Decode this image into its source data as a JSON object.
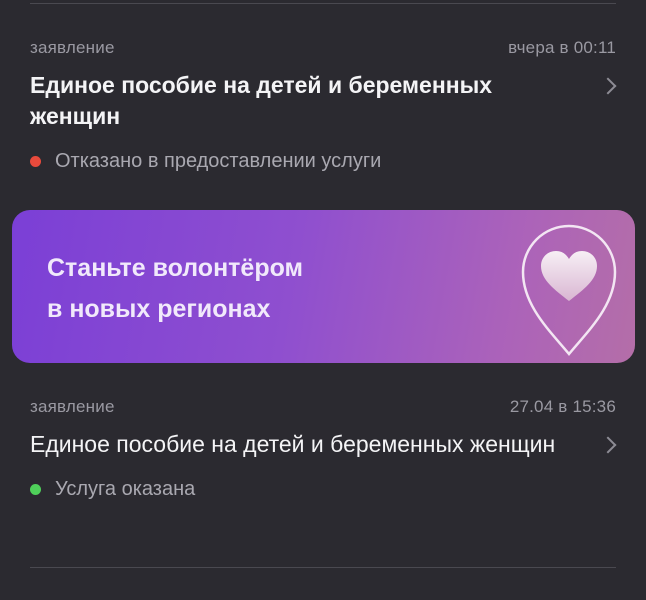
{
  "items": [
    {
      "type_label": "заявление",
      "time": "вчера в 00:11",
      "title": "Единое пособие на детей и беременных женщин",
      "status": "Отказано в предоставлении услуги",
      "status_color": "#e84a3c"
    },
    {
      "type_label": "заявление",
      "time": "27.04 в 15:36",
      "title": "Единое пособие на детей и беременных женщин",
      "status": "Услуга оказана",
      "status_color": "#4fd05a"
    }
  ],
  "banner": {
    "line1": "Станьте волонтёром",
    "line2": "в новых регионах",
    "icon": "heart-location-pin-icon",
    "gradient_start": "#7b3fd6",
    "gradient_end": "#b46ea8"
  },
  "theme": {
    "background": "#2b2a30"
  }
}
